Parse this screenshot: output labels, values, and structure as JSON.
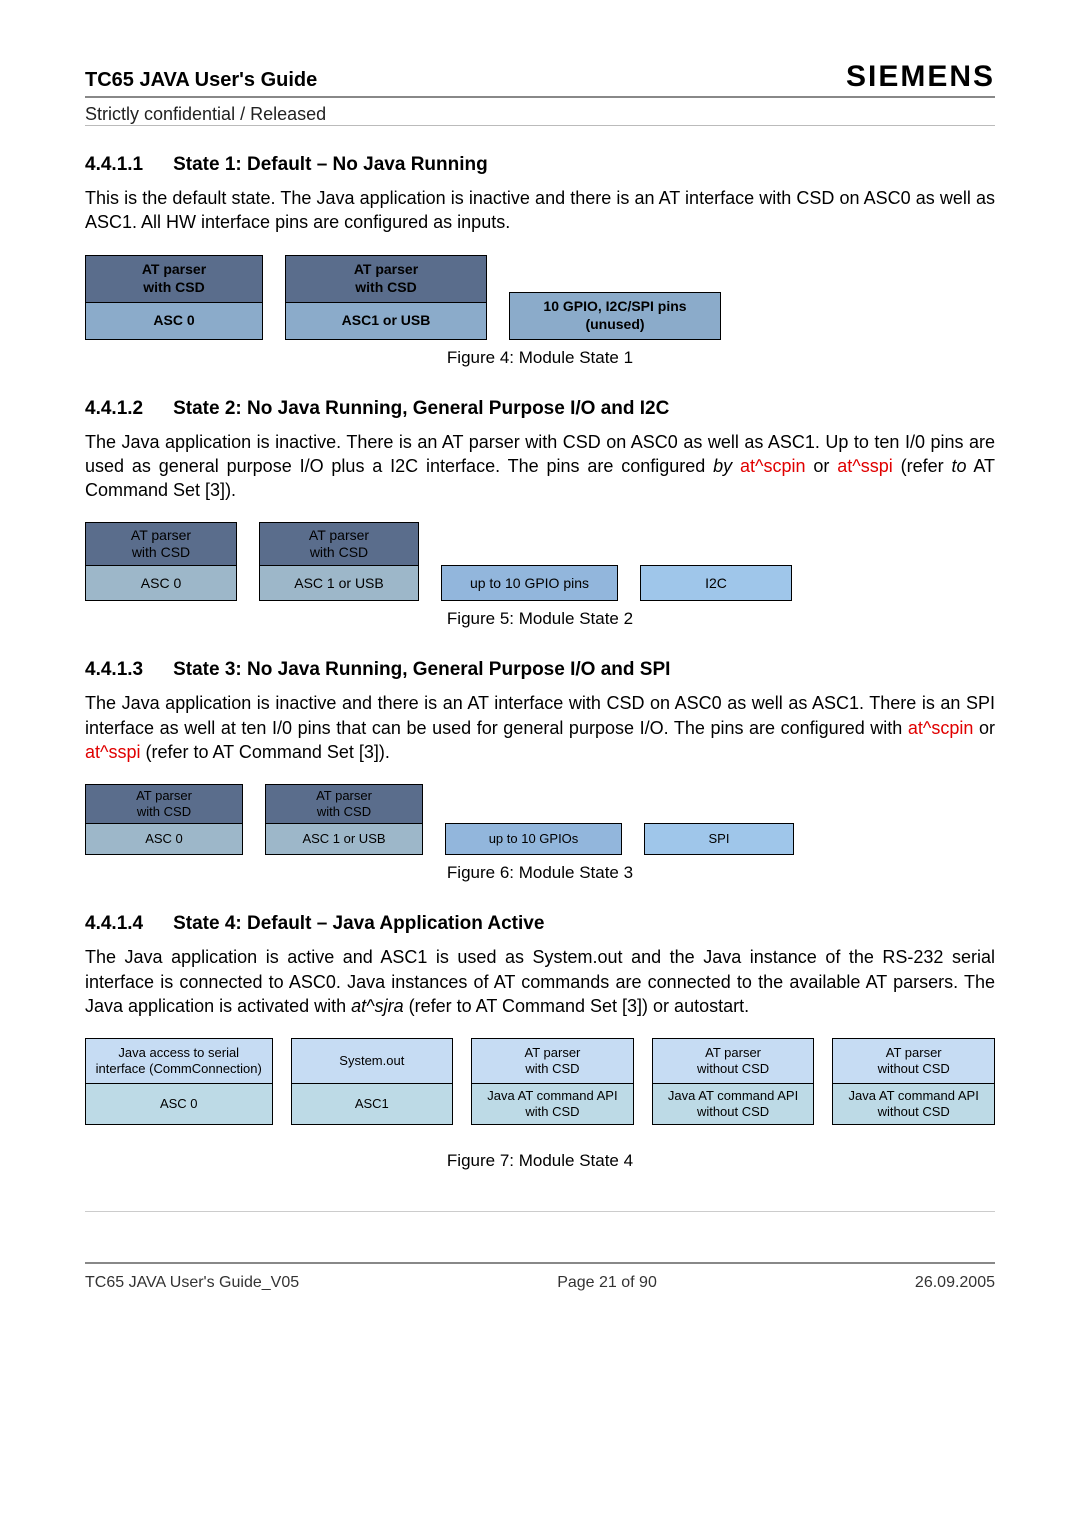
{
  "header": {
    "title": "TC65 JAVA User's Guide",
    "subtitle": "Strictly confidential / Released",
    "brand": "SIEMENS"
  },
  "sections": {
    "s1": {
      "num": "4.4.1.1",
      "title": "State 1: Default – No Java Running"
    },
    "s2": {
      "num": "4.4.1.2",
      "title": "State 2: No Java Running, General Purpose I/O and I2C"
    },
    "s3": {
      "num": "4.4.1.3",
      "title": "State 3: No Java Running, General Purpose I/O and SPI"
    },
    "s4": {
      "num": "4.4.1.4",
      "title": "State 4: Default – Java Application Active"
    }
  },
  "paras": {
    "p1": "This is the default state. The Java application is inactive and there is an AT interface with CSD on ASC0 as well as ASC1. All HW interface pins are configured as inputs.",
    "p2a": "The Java application is inactive. There is an AT parser with CSD on ASC0 as well as ASC1. Up to ten I/0 pins are used as general purpose I/O plus a I2C interface. The pins are configured ",
    "p2b": "by",
    "p2c": " at^scpin",
    "p2d": " or ",
    "p2e": "at^sspi",
    "p2f": " (refer ",
    "p2g": "to",
    "p2h": " AT Command Set [3]).",
    "p3a": "The Java application is inactive and there is an AT interface with CSD on ASC0 as well as ASC1. There is an SPI interface as well at ten I/0 pins that can be used for general purpose I/O. The pins are configured with ",
    "p3b": "at^scpin",
    "p3c": " or ",
    "p3d": "at^sspi",
    "p3e": " (refer to AT Command Set [3]).",
    "p4a": "The Java application is active and ASC1 is used as System.out and the Java instance of the RS-232 serial interface is connected to ASC0. Java instances of AT commands are connected to the available AT parsers. The Java application is activated with ",
    "p4b": "at^sjra",
    "p4c": " (refer to AT Command Set [3]) or autostart."
  },
  "figs": {
    "f1": "Figure 4: Module State 1",
    "f2": "Figure 5: Module State 2",
    "f3": "Figure 6: Module State 3",
    "f4": "Figure 7: Module State 4"
  },
  "d1": {
    "a_top": "AT parser\nwith CSD",
    "a_bot": "ASC 0",
    "b_top": "AT parser\nwith CSD",
    "b_bot": "ASC1 or USB",
    "pins": "10 GPIO, I2C/SPI  pins\n(unused)"
  },
  "d2": {
    "a_top": "AT parser\nwith CSD",
    "a_bot": "ASC 0",
    "b_top": "AT parser\nwith CSD",
    "b_bot": "ASC 1 or USB",
    "gpio": "up to 10 GPIO pins",
    "i2c": "I2C"
  },
  "d3": {
    "a_top": "AT parser\nwith CSD",
    "a_bot": "ASC 0",
    "b_top": "AT parser\nwith CSD",
    "b_bot": "ASC 1 or USB",
    "gpio": "up to 10 GPIOs",
    "spi": "SPI"
  },
  "d4": {
    "c1_top": "Java access to serial\ninterface (CommConnection)",
    "c1_bot": "ASC 0",
    "c2_top": "System.out",
    "c2_bot": "ASC1",
    "c3_top": "AT parser\nwith CSD",
    "c3_bot": "Java AT command API\nwith CSD",
    "c4_top": "AT parser\nwithout CSD",
    "c4_bot": "Java AT command API\nwithout CSD",
    "c5_top": "AT parser\nwithout CSD",
    "c5_bot": "Java AT command API\nwithout CSD"
  },
  "footer": {
    "left": "TC65 JAVA User's Guide_V05",
    "center": "Page 21 of 90",
    "right": "26.09.2005"
  }
}
